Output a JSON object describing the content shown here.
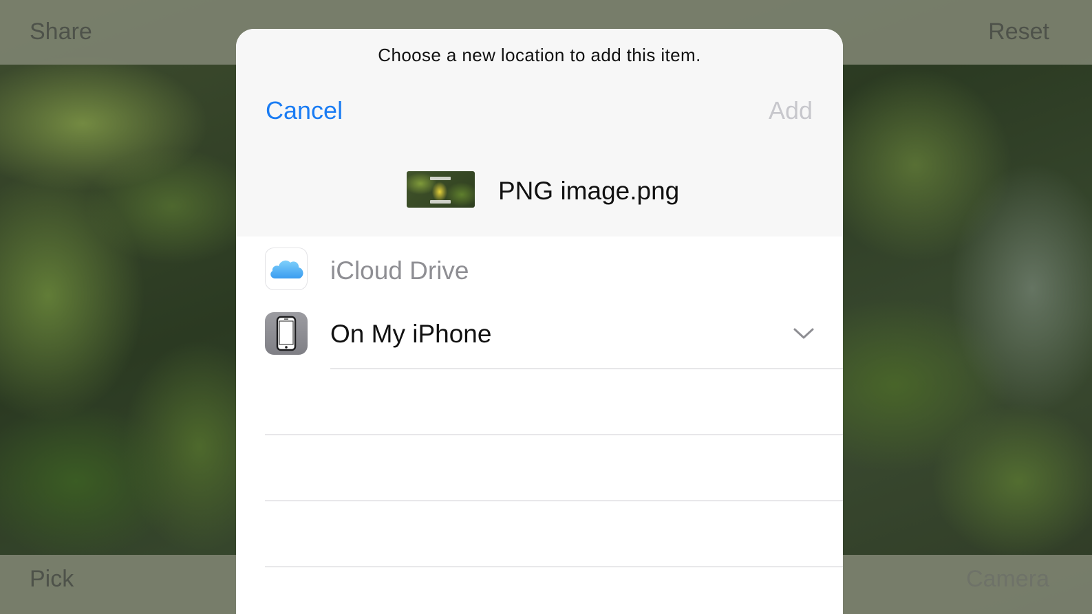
{
  "background": {
    "top_bar": {
      "left_label": "Share",
      "right_label": "Reset"
    },
    "bottom_bar": {
      "left_label": "Pick",
      "right_label": "Camera"
    }
  },
  "sheet": {
    "prompt": "Choose a new location to add this item.",
    "cancel_label": "Cancel",
    "add_label": "Add",
    "file": {
      "name": "PNG image.png",
      "icon": "png-thumbnail"
    },
    "locations": [
      {
        "label": "iCloud Drive",
        "icon": "icloud-icon",
        "enabled": false
      },
      {
        "label": "On My iPhone",
        "icon": "iphone-icon",
        "enabled": true,
        "expandable": true,
        "expand_icon": "chevron-down-icon"
      }
    ]
  },
  "colors": {
    "accent": "#1a7cf3",
    "disabled": "#c7c7cc",
    "secondary_text": "#8e8e93"
  }
}
